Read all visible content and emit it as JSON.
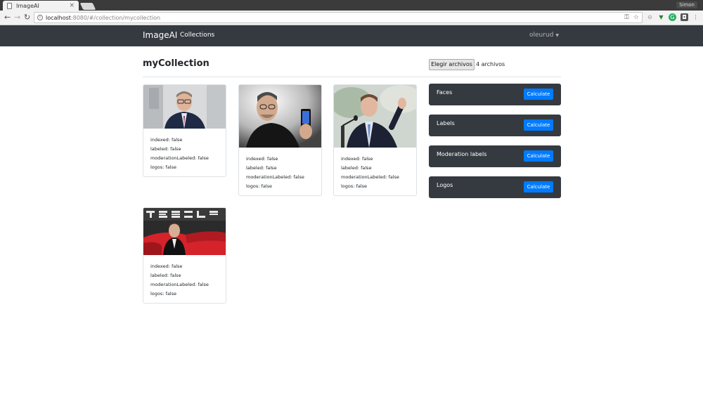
{
  "browser": {
    "tab_title": "ImageAI",
    "tab_close": "×",
    "profile_name": "Simon",
    "url_host": "localhost",
    "url_rest": ":8080/#/collection/mycollection"
  },
  "navbar": {
    "brand": "ImageAI",
    "collections_link": "Collections",
    "user": "oleurud"
  },
  "main": {
    "title": "myCollection",
    "file_button": "Elegir archivos",
    "file_count": "4 archivos"
  },
  "images": [
    {
      "photo": "portrait-man-glasses-suit",
      "indexed": "indexed: false",
      "labeled": "labeled: false",
      "moderation": "moderationLabeled: false",
      "logos": "logos: false"
    },
    {
      "photo": "portrait-man-holding-phone",
      "indexed": "indexed: false",
      "labeled": "labeled: false",
      "moderation": "moderationLabeled: false",
      "logos": "logos: false"
    },
    {
      "photo": "portrait-man-speaking-microphone",
      "indexed": "indexed: false",
      "labeled": "labeled: false",
      "moderation": "moderationLabeled: false",
      "logos": "logos: false"
    },
    {
      "photo": "man-in-red-car",
      "indexed": "indexed: false",
      "labeled": "labeled: false",
      "moderation": "moderationLabeled: false",
      "logos": "logos: false"
    }
  ],
  "panels": [
    {
      "label": "Faces",
      "button": "Calculate"
    },
    {
      "label": "Labels",
      "button": "Calculate"
    },
    {
      "label": "Moderation labels",
      "button": "Calculate"
    },
    {
      "label": "Logos",
      "button": "Calculate"
    }
  ],
  "colors": {
    "navbar": "#343a40",
    "primary": "#007bff"
  }
}
